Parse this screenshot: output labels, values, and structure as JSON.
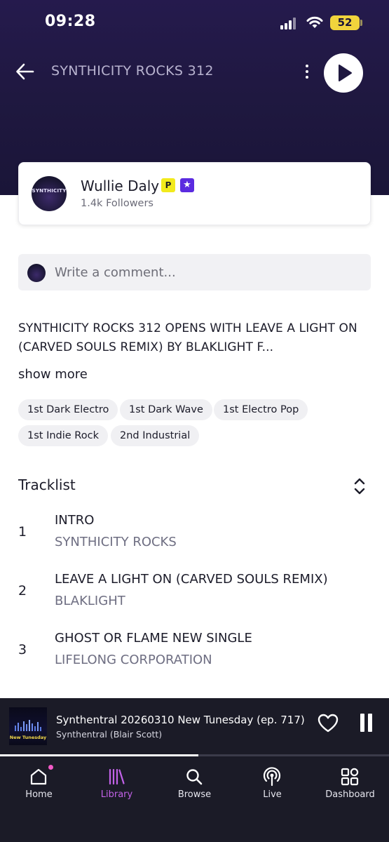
{
  "status_bar": {
    "time": "09:28",
    "battery": "52",
    "signal_icon": "signal-bars-icon",
    "wifi_icon": "wifi-icon"
  },
  "header": {
    "title": "SYNTHICITY ROCKS 312",
    "back_icon": "arrow-left-icon",
    "more_icon": "more-vertical-icon",
    "play_icon": "play-icon"
  },
  "artist": {
    "name": "Wullie Daly",
    "followers": "1.4k Followers",
    "badge_pro": "P",
    "badge_star": "★",
    "avatar_text": "SYNTHICITY",
    "badge_pro_color": "#f2ea1c",
    "badge_star_color": "#5b2be0"
  },
  "comment": {
    "placeholder": "Write a comment..."
  },
  "description": {
    "text": "SYNTHICITY ROCKS 312 OPENS WITH LEAVE A LIGHT ON (CARVED SOULS REMIX) BY BLAKLIGHT F...",
    "show_more": "show more"
  },
  "tags": [
    "1st Dark Electro",
    "1st Dark Wave",
    "1st Electro Pop",
    "1st Indie Rock",
    "2nd Industrial"
  ],
  "tracklist": {
    "title": "Tracklist",
    "expand_icon": "chevron-up-down-icon",
    "tracks": [
      {
        "number": "1",
        "title": "INTRO",
        "artist": "SYNTHICITY ROCKS"
      },
      {
        "number": "2",
        "title": "LEAVE A LIGHT ON (CARVED SOULS REMIX)",
        "artist": "BLAKLIGHT"
      },
      {
        "number": "3",
        "title": "GHOST OR FLAME NEW SINGLE",
        "artist": "LIFELONG CORPORATION"
      }
    ]
  },
  "now_playing": {
    "title": "Synthentral 20260310 New Tunesday (ep. 717)",
    "artist": "Synthentral (Blair Scott)",
    "art_text": "New Tunesday",
    "progress": 0.51,
    "heart_icon": "heart-outline-icon",
    "pause_icon": "pause-icon"
  },
  "nav": {
    "active": "Library",
    "accent_color": "#c262e8",
    "items": [
      {
        "label": "Home",
        "icon": "home-icon"
      },
      {
        "label": "Library",
        "icon": "library-icon"
      },
      {
        "label": "Browse",
        "icon": "search-icon"
      },
      {
        "label": "Live",
        "icon": "broadcast-icon"
      },
      {
        "label": "Dashboard",
        "icon": "dashboard-grid-icon"
      }
    ]
  },
  "colors": {
    "header_bg": "#221847",
    "player_bg": "#1b1b27",
    "accent": "#c262e8",
    "notification_dot": "#f25ac6"
  }
}
